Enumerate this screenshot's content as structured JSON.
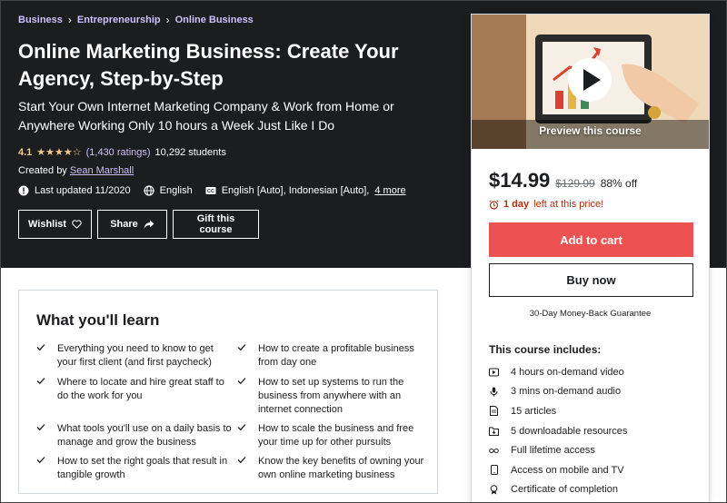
{
  "breadcrumbs": [
    "Business",
    "Entrepreneurship",
    "Online Business"
  ],
  "course": {
    "title": "Online Marketing Business: Create Your Agency, Step-by-Step",
    "subtitle": "Start Your Own Internet Marketing Company & Work from Home or Anywhere Working Only 10 hours a Week Just Like I Do",
    "rating": "4.1",
    "rating_stars": 4.1,
    "ratings_count": "(1,430 ratings)",
    "students": "10,292 students",
    "created_by_label": "Created by",
    "instructor": "Sean Marshall",
    "last_updated": "Last updated 11/2020",
    "language": "English",
    "captions": "English [Auto], Indonesian [Auto],",
    "captions_more": "4 more"
  },
  "actions": {
    "wishlist": "Wishlist",
    "share": "Share",
    "gift": "Gift this course"
  },
  "sidebar": {
    "preview_label": "Preview this course",
    "price": "$14.99",
    "original_price": "$129.99",
    "discount": "88% off",
    "timer_bold": "1 day",
    "timer_rest": "left at this price!",
    "add_to_cart": "Add to cart",
    "buy_now": "Buy now",
    "guarantee": "30-Day Money-Back Guarantee",
    "includes_title": "This course includes:",
    "includes": [
      {
        "icon": "video-icon",
        "text": "4 hours on-demand video"
      },
      {
        "icon": "microphone-icon",
        "text": "3 mins on-demand audio"
      },
      {
        "icon": "article-icon",
        "text": "15 articles"
      },
      {
        "icon": "folder-download-icon",
        "text": "5 downloadable resources"
      },
      {
        "icon": "infinity-icon",
        "text": "Full lifetime access"
      },
      {
        "icon": "mobile-icon",
        "text": "Access on mobile and TV"
      },
      {
        "icon": "certificate-icon",
        "text": "Certificate of completion"
      }
    ]
  },
  "learn": {
    "title": "What you'll learn",
    "left": [
      "Everything you need to know to get your first client (and first paycheck)",
      "Where to locate and hire great staff to do the work for you",
      "What tools you'll use on a daily basis to manage and grow the business",
      "How to set the right goals that result in tangible growth"
    ],
    "right": [
      "How to create a profitable business from day one",
      "How to set up systems to run the business from anywhere with an internet connection",
      "How to scale the business and free your time up for other pursuits",
      "Know the key benefits of owning your own online marketing business"
    ]
  },
  "colors": {
    "header_bg": "#1c1d1f",
    "link_purple": "#cec0fc",
    "star_gold": "#f3ca8c",
    "cart_red": "#ec5252",
    "timer_red": "#b32d0f"
  }
}
